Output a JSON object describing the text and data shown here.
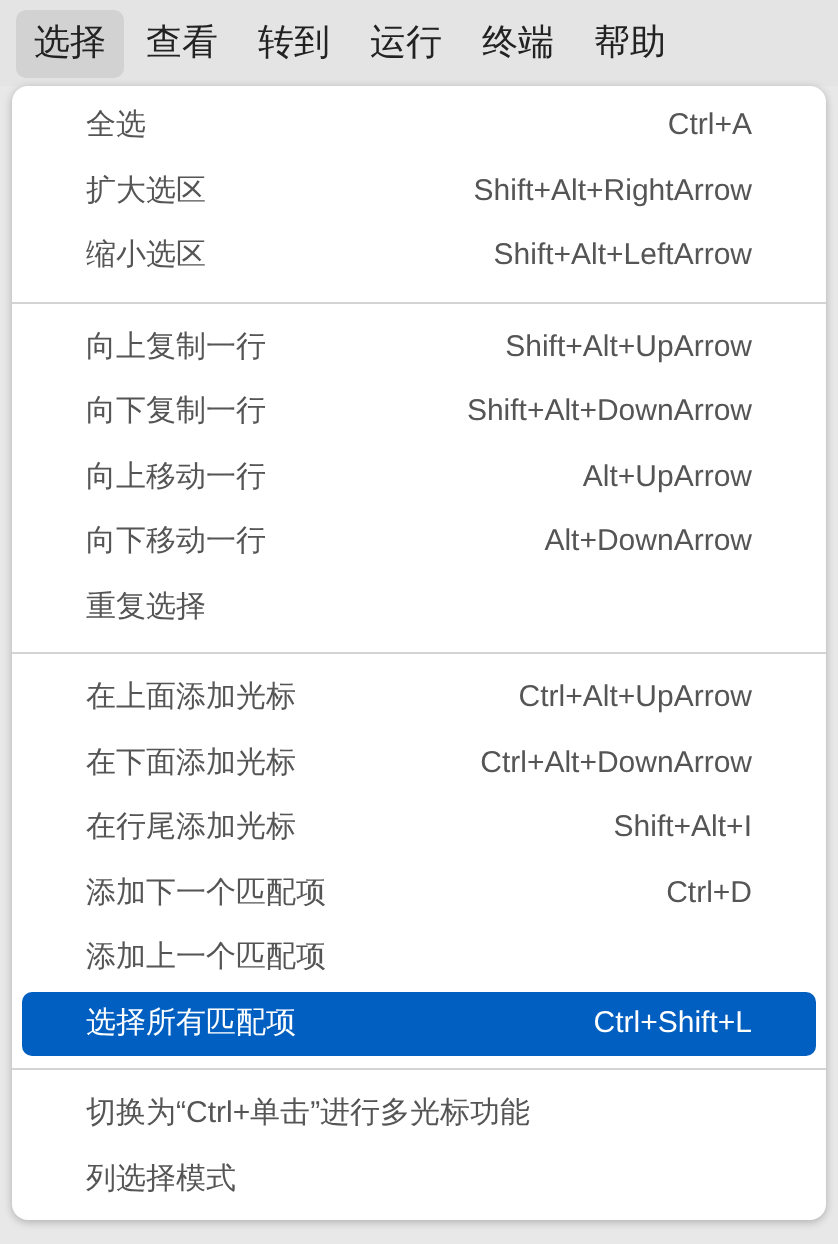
{
  "menubar": [
    {
      "label": "选择",
      "selected": true
    },
    {
      "label": "查看",
      "selected": false
    },
    {
      "label": "转到",
      "selected": false
    },
    {
      "label": "运行",
      "selected": false
    },
    {
      "label": "终端",
      "selected": false
    },
    {
      "label": "帮助",
      "selected": false
    }
  ],
  "menu": {
    "groups": [
      {
        "items": [
          {
            "label": "全选",
            "shortcut": "Ctrl+A",
            "selected": false
          },
          {
            "label": "扩大选区",
            "shortcut": "Shift+Alt+RightArrow",
            "selected": false
          },
          {
            "label": "缩小选区",
            "shortcut": "Shift+Alt+LeftArrow",
            "selected": false
          }
        ]
      },
      {
        "items": [
          {
            "label": "向上复制一行",
            "shortcut": "Shift+Alt+UpArrow",
            "selected": false
          },
          {
            "label": "向下复制一行",
            "shortcut": "Shift+Alt+DownArrow",
            "selected": false
          },
          {
            "label": "向上移动一行",
            "shortcut": "Alt+UpArrow",
            "selected": false
          },
          {
            "label": "向下移动一行",
            "shortcut": "Alt+DownArrow",
            "selected": false
          },
          {
            "label": "重复选择",
            "selected": false
          }
        ]
      },
      {
        "items": [
          {
            "label": "在上面添加光标",
            "shortcut": "Ctrl+Alt+UpArrow",
            "selected": false
          },
          {
            "label": "在下面添加光标",
            "shortcut": "Ctrl+Alt+DownArrow",
            "selected": false
          },
          {
            "label": "在行尾添加光标",
            "shortcut": "Shift+Alt+I",
            "selected": false
          },
          {
            "label": "添加下一个匹配项",
            "shortcut": "Ctrl+D",
            "selected": false
          },
          {
            "label": "添加上一个匹配项",
            "selected": false
          },
          {
            "label": "选择所有匹配项",
            "shortcut": "Ctrl+Shift+L",
            "selected": true
          }
        ]
      },
      {
        "items": [
          {
            "label": "切换为“Ctrl+单击”进行多光标功能",
            "selected": false
          },
          {
            "label": "列选择模式",
            "selected": false
          }
        ]
      }
    ]
  }
}
